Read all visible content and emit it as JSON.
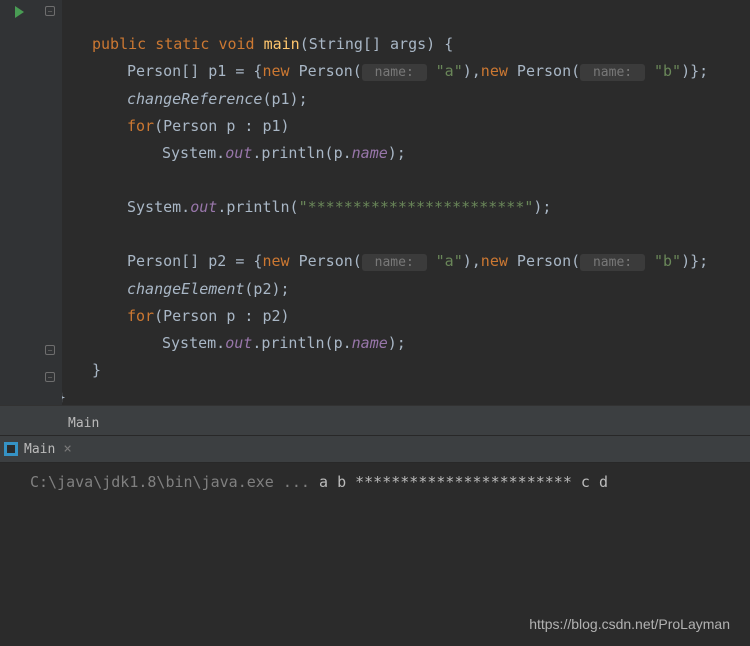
{
  "code": {
    "sig_public": "public",
    "sig_static": "static",
    "sig_void": "void",
    "sig_main": "main",
    "sig_params": "(String[] args) {",
    "l2_a": "Person[] p1 = {",
    "l2_new1": "new",
    "l2_person1": " Person(",
    "l2_hint1": " name: ",
    "l2_str1": "\"a\"",
    "l2_mid": "),",
    "l2_new2": "new",
    "l2_person2": " Person(",
    "l2_hint2": " name: ",
    "l2_str2": "\"b\"",
    "l2_end": ")};",
    "l3_call": "changeReference",
    "l3_arg": "(p1);",
    "l4_for": "for",
    "l4_expr": "(Person p : p1)",
    "l5_sys": "System.",
    "l5_out": "out",
    "l5_print": ".println(p.",
    "l5_name": "name",
    "l5_end": ");",
    "l7_sys": "System.",
    "l7_out": "out",
    "l7_print": ".println(",
    "l7_str": "\"************************\"",
    "l7_end": ");",
    "l9_a": "Person[] p2 = {",
    "l9_new1": "new",
    "l9_str1": "\"a\"",
    "l9_str2": "\"b\"",
    "l10_call": "changeElement",
    "l10_arg": "(p2);",
    "l11_for": "for",
    "l11_expr": "(Person p : p2)",
    "l12_sys": "System.",
    "l12_out": "out",
    "l12_print": ".println(p.",
    "l12_name": "name",
    "l12_end": ");",
    "close1": "}",
    "close2": "}"
  },
  "tabs": {
    "config": "Main",
    "run": "Main"
  },
  "console": {
    "cmd": "C:\\java\\jdk1.8\\bin\\java.exe ...",
    "lines": [
      "a",
      "b",
      "************************",
      "c",
      "d"
    ]
  },
  "watermark": "https://blog.csdn.net/ProLayman"
}
